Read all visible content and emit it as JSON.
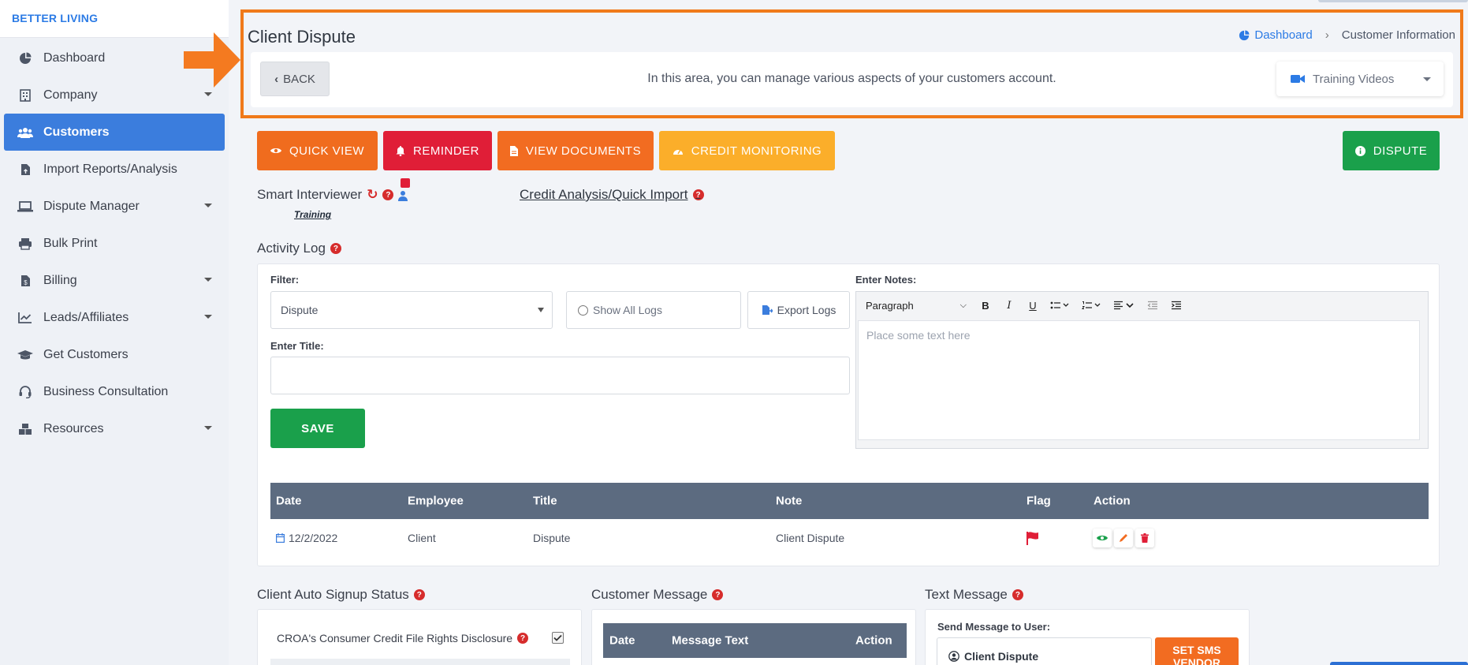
{
  "brand": "BETTER LIVING",
  "sidebar": {
    "items": [
      {
        "label": "Dashboard",
        "icon": "pie-chart-icon",
        "caret": false,
        "active": false
      },
      {
        "label": "Company",
        "icon": "building-icon",
        "caret": true,
        "active": false
      },
      {
        "label": "Customers",
        "icon": "users-icon",
        "caret": false,
        "active": true
      },
      {
        "label": "Import Reports/Analysis",
        "icon": "file-upload-icon",
        "caret": false,
        "active": false
      },
      {
        "label": "Dispute Manager",
        "icon": "laptop-icon",
        "caret": true,
        "active": false
      },
      {
        "label": "Bulk Print",
        "icon": "printer-icon",
        "caret": false,
        "active": false
      },
      {
        "label": "Billing",
        "icon": "invoice-icon",
        "caret": true,
        "active": false
      },
      {
        "label": "Leads/Affiliates",
        "icon": "chart-line-icon",
        "caret": true,
        "active": false
      },
      {
        "label": "Get Customers",
        "icon": "graduation-cap-icon",
        "caret": false,
        "active": false
      },
      {
        "label": "Business Consultation",
        "icon": "headset-icon",
        "caret": false,
        "active": false
      },
      {
        "label": "Resources",
        "icon": "boxes-icon",
        "caret": true,
        "active": false
      }
    ]
  },
  "header": {
    "title": "Client Dispute",
    "breadcrumb": {
      "home": "Dashboard",
      "current": "Customer Information"
    },
    "back_label": "BACK",
    "description": "In this area, you can manage various aspects of your customers account.",
    "training_videos": "Training Videos"
  },
  "actions": {
    "quick_view": "QUICK VIEW",
    "reminder": "REMINDER",
    "view_documents": "VIEW DOCUMENTS",
    "credit_monitoring": "CREDIT MONITORING",
    "dispute": "DISPUTE"
  },
  "links": {
    "smart_interviewer": "Smart Interviewer",
    "training": "Training",
    "credit_analysis": "Credit Analysis/Quick Import"
  },
  "activity": {
    "title": "Activity Log",
    "filter_label": "Filter:",
    "filter_value": "Dispute",
    "show_all": "Show All Logs",
    "export": "Export Logs",
    "title_label": "Enter Title:",
    "save": "SAVE",
    "notes_label": "Enter Notes:",
    "editor_format": "Paragraph",
    "editor_placeholder": "Place some text here",
    "columns": [
      "Date",
      "Employee",
      "Title",
      "Note",
      "Flag",
      "Action"
    ],
    "rows": [
      {
        "date": "12/2/2022",
        "employee": "Client",
        "title": "Dispute",
        "note": "Client Dispute"
      }
    ]
  },
  "signup": {
    "title": "Client Auto Signup Status",
    "item": "CROA's Consumer Credit File Rights Disclosure"
  },
  "customer_message": {
    "title": "Customer Message",
    "columns": [
      "Date",
      "Message Text",
      "Action"
    ]
  },
  "text_message": {
    "title": "Text Message",
    "send_label": "Send Message to User:",
    "recipient": "Client Dispute",
    "sms_button": "SET SMS VENDOR"
  },
  "colors": {
    "accent_blue": "#3b7ddd",
    "highlight_orange": "#f07a1a",
    "green": "#1aa04b",
    "red": "#e01e37",
    "yellow": "#fbae2a",
    "table_header": "#5c6b80"
  }
}
